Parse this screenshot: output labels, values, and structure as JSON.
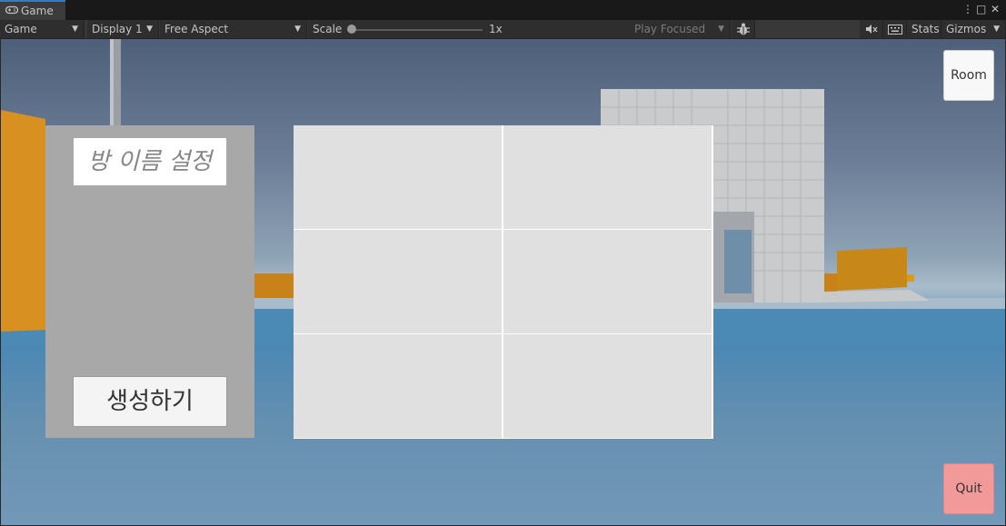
{
  "tab": {
    "label": "Game",
    "icon": "gamepad-icon"
  },
  "window_controls": {
    "menu": "⋮",
    "maximize": "□",
    "close": "✕"
  },
  "toolbar": {
    "view_mode": "Game",
    "display": "Display 1",
    "aspect": "Free Aspect",
    "scale_label": "Scale",
    "scale_value": "1x",
    "scale_fraction": 0,
    "play_mode": "Play Focused",
    "stats": "Stats",
    "gizmos": "Gizmos"
  },
  "game_ui": {
    "room_name_placeholder": "방 이름 설정",
    "create_button": "생성하기",
    "room_list_slots": 6,
    "room_button": "Room",
    "quit_button": "Quit"
  },
  "colors": {
    "panel": "#a8a8a8",
    "quit_button": "#f29a9a",
    "tab_accent": "#3a79bb"
  }
}
